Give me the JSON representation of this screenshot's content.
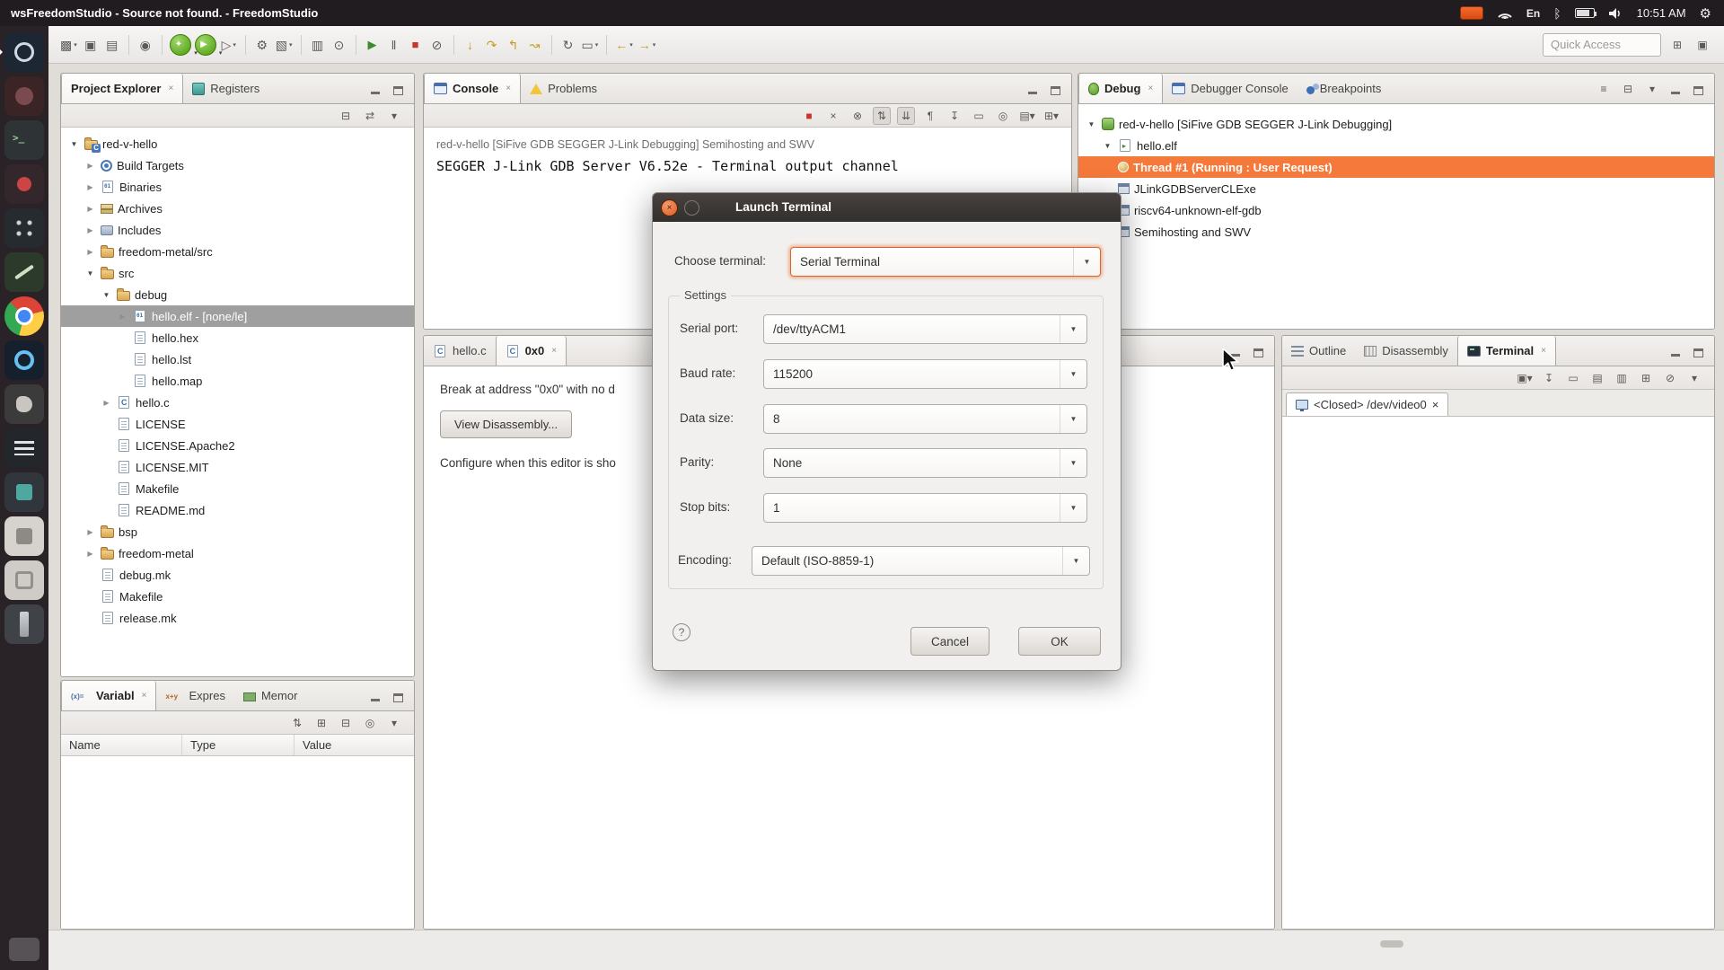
{
  "system_bar": {
    "title": "wsFreedomStudio - Source not found. - FreedomStudio",
    "keyboard_layout": "En",
    "clock": "10:51 AM"
  },
  "icons": {
    "caret": "▾",
    "close": "×",
    "combo_arrow": "▼",
    "expanded": "▼",
    "collapsed": "▶",
    "gear": "⚙",
    "bluetooth": "ᛒ"
  },
  "quick_access": {
    "placeholder": "Quick Access"
  },
  "main_toolbar": {
    "icons": [
      {
        "name": "new-wizard",
        "glyph": "▩"
      },
      {
        "name": "save",
        "glyph": "▣"
      },
      {
        "name": "save-all",
        "glyph": "▤"
      },
      {
        "name": "skip-all-breakpoints",
        "glyph": "◉"
      },
      {
        "name": "debug-launch",
        "glyph": "✦"
      },
      {
        "name": "run-launch",
        "glyph": "▶"
      },
      {
        "name": "external-tools",
        "glyph": "▷"
      },
      {
        "name": "build",
        "glyph": "⚙"
      },
      {
        "name": "new-c-project",
        "glyph": "▧"
      },
      {
        "name": "open-console",
        "glyph": "▥"
      },
      {
        "name": "search",
        "glyph": "⊙"
      },
      {
        "name": "resume",
        "glyph": "▶"
      },
      {
        "name": "suspend",
        "glyph": "‖"
      },
      {
        "name": "terminate",
        "glyph": "■"
      },
      {
        "name": "disconnect",
        "glyph": "⊘"
      },
      {
        "name": "step-into",
        "glyph": "↓"
      },
      {
        "name": "step-over",
        "glyph": "↷"
      },
      {
        "name": "step-return",
        "glyph": "↰"
      },
      {
        "name": "instruction-step",
        "glyph": "↝"
      },
      {
        "name": "restart",
        "glyph": "↻"
      },
      {
        "name": "open-new-view",
        "glyph": "▭"
      },
      {
        "name": "back",
        "glyph": "←"
      },
      {
        "name": "forward",
        "glyph": "→"
      }
    ]
  },
  "project_explorer": {
    "tab_project_explorer": "Project Explorer",
    "tab_registers": "Registers",
    "toolbar": [
      {
        "name": "collapse-all",
        "glyph": "⊟"
      },
      {
        "name": "link-with-editor",
        "glyph": "⇄"
      },
      {
        "name": "view-menu",
        "glyph": "▾"
      }
    ],
    "tree": [
      {
        "label": "red-v-hello"
      },
      {
        "label": "Build Targets"
      },
      {
        "label": "Binaries"
      },
      {
        "label": "Archives"
      },
      {
        "label": "Includes"
      },
      {
        "label": "freedom-metal/src"
      },
      {
        "label": "src"
      },
      {
        "label": "debug"
      },
      {
        "label": "hello.elf - [none/le]"
      },
      {
        "label": "hello.hex"
      },
      {
        "label": "hello.lst"
      },
      {
        "label": "hello.map"
      },
      {
        "label": "hello.c"
      },
      {
        "label": "LICENSE"
      },
      {
        "label": "LICENSE.Apache2"
      },
      {
        "label": "LICENSE.MIT"
      },
      {
        "label": "Makefile"
      },
      {
        "label": "README.md"
      },
      {
        "label": "bsp"
      },
      {
        "label": "freedom-metal"
      },
      {
        "label": "debug.mk"
      },
      {
        "label": "Makefile"
      },
      {
        "label": "release.mk"
      }
    ]
  },
  "variables_panel": {
    "tab_variables": "Variabl",
    "tab_expressions": "Expres",
    "tab_memory": "Memor",
    "toolbar": [
      {
        "name": "show-type-names",
        "glyph": "⇅"
      },
      {
        "name": "add-watch",
        "glyph": "⊞"
      },
      {
        "name": "remove-all",
        "glyph": "⊟"
      },
      {
        "name": "pin",
        "glyph": "◎"
      },
      {
        "name": "view-menu",
        "glyph": "▾"
      }
    ],
    "columns": [
      "Name",
      "Type",
      "Value"
    ]
  },
  "console_panel": {
    "tab_console": "Console",
    "tab_problems": "Problems",
    "toolbar": [
      {
        "name": "terminate",
        "glyph": "■"
      },
      {
        "name": "remove-launch",
        "glyph": "×"
      },
      {
        "name": "remove-all-launches",
        "glyph": "⊗"
      },
      {
        "name": "show-console-stdout",
        "glyph": "⇅"
      },
      {
        "name": "show-console-stderr",
        "glyph": "⇊"
      },
      {
        "name": "word-wrap",
        "glyph": "¶"
      },
      {
        "name": "scroll-lock",
        "glyph": "↧"
      },
      {
        "name": "clear-console",
        "glyph": "▭"
      },
      {
        "name": "pin-console",
        "glyph": "◎"
      },
      {
        "name": "display-selected-console",
        "glyph": "▤"
      },
      {
        "name": "open-console",
        "glyph": "⊞"
      }
    ],
    "title_line": "red-v-hello [SiFive GDB SEGGER J-Link Debugging] Semihosting and SWV",
    "output_line": "SEGGER J-Link GDB Server V6.52e - Terminal output channel"
  },
  "editor": {
    "tab_hello_c": "hello.c",
    "tab_0x0": "0x0",
    "break_message": "Break at address \"0x0\" with no d",
    "view_disassembly_button": "View Disassembly...",
    "configure_message": "Configure when this editor is sho"
  },
  "debug_panel": {
    "tab_debug": "Debug",
    "tab_debugger_console": "Debugger Console",
    "tab_breakpoints": "Breakpoints",
    "header_icons": [
      {
        "name": "view-layout",
        "glyph": "≡"
      },
      {
        "name": "collapse-all",
        "glyph": "⊟"
      },
      {
        "name": "view-menu",
        "glyph": "▾"
      }
    ],
    "tree": [
      {
        "label": "red-v-hello [SiFive GDB SEGGER J-Link Debugging]"
      },
      {
        "label": "hello.elf"
      },
      {
        "label": "Thread #1 (Running : User Request)"
      },
      {
        "label": "JLinkGDBServerCLExe"
      },
      {
        "label": "riscv64-unknown-elf-gdb"
      },
      {
        "label": "Semihosting and SWV"
      }
    ]
  },
  "right_panel": {
    "tab_outline": "Outline",
    "tab_disassembly": "Disassembly",
    "tab_terminal": "Terminal",
    "toolbar": [
      {
        "name": "open-terminal",
        "glyph": "▣"
      },
      {
        "name": "scroll-lock",
        "glyph": "↧"
      },
      {
        "name": "clear-terminal",
        "glyph": "▭"
      },
      {
        "name": "split-horizontal",
        "glyph": "▤"
      },
      {
        "name": "split-vertical",
        "glyph": "▥"
      },
      {
        "name": "new-terminal-tab",
        "glyph": "⊞"
      },
      {
        "name": "disconnect",
        "glyph": "⊘"
      },
      {
        "name": "view-menu",
        "glyph": "▾"
      }
    ],
    "terminal_tab": "<Closed> /dev/video0"
  },
  "dialog": {
    "title": "Launch Terminal",
    "choose_terminal_label": "Choose terminal:",
    "choose_terminal_value": "Serial Terminal",
    "settings_group_label": "Settings",
    "serial_port_label": "Serial port:",
    "serial_port_value": "/dev/ttyACM1",
    "baud_rate_label": "Baud rate:",
    "baud_rate_value": "115200",
    "data_size_label": "Data size:",
    "data_size_value": "8",
    "parity_label": "Parity:",
    "parity_value": "None",
    "stop_bits_label": "Stop bits:",
    "stop_bits_value": "1",
    "encoding_label": "Encoding:",
    "encoding_value": "Default (ISO-8859-1)",
    "help_glyph": "?",
    "cancel_button": "Cancel",
    "ok_button": "OK"
  },
  "colors": {
    "accent": "#f07746",
    "debug_selection": "#f4793b",
    "panel_dark": "#211c20"
  }
}
